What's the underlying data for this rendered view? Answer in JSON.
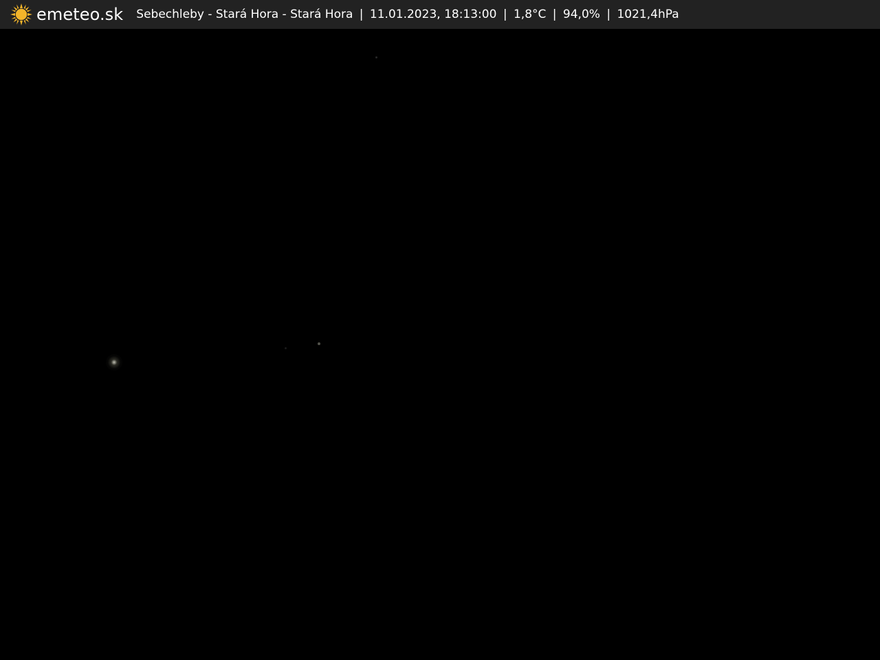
{
  "header": {
    "brand": "emeteo.sk",
    "location": "Sebechleby - Stará Hora - Stará Hora",
    "datetime": "11.01.2023, 18:13:00",
    "temperature": "1,8°C",
    "humidity": "94,0%",
    "pressure": "1021,4hPa",
    "separator": "|"
  },
  "icons": {
    "logo": "sun-icon"
  },
  "colors": {
    "header_bg": "#222222",
    "text": "#ffffff",
    "sun": "#f3b52a",
    "image_bg": "#000000"
  }
}
